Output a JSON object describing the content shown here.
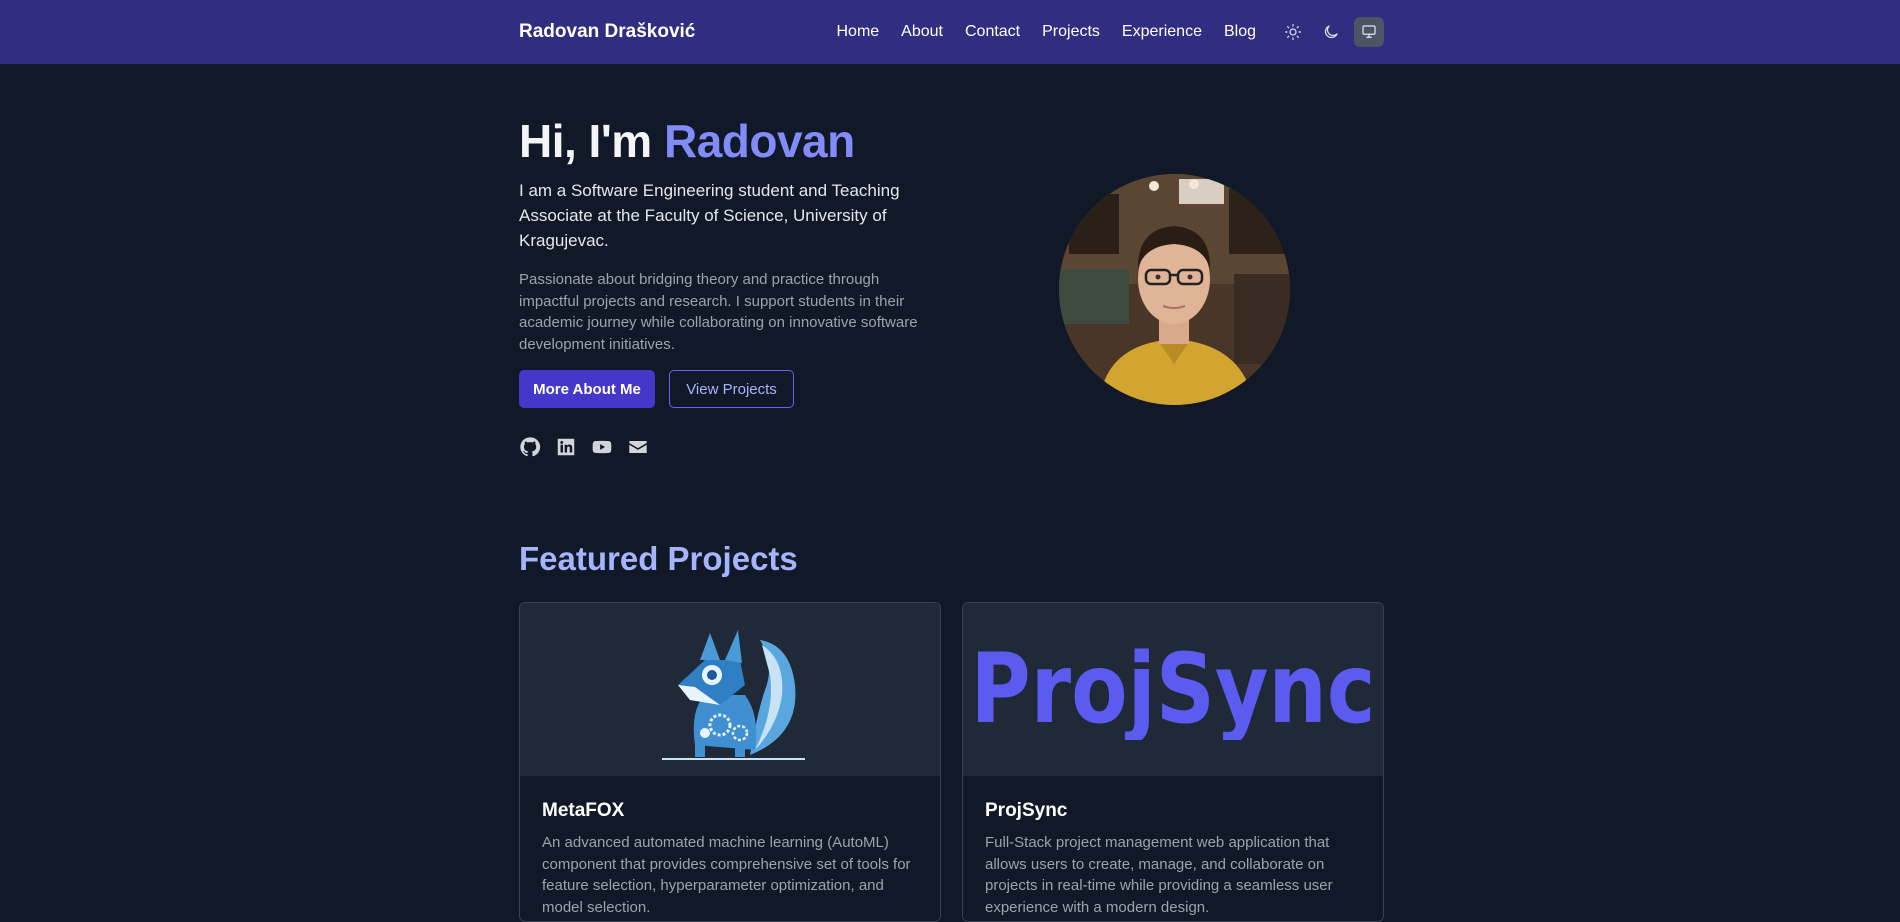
{
  "header": {
    "brand": "Radovan Drašković",
    "nav": [
      "Home",
      "About",
      "Contact",
      "Projects",
      "Experience",
      "Blog"
    ],
    "theme_buttons": [
      "sun-icon",
      "moon-icon",
      "monitor-icon"
    ],
    "active_theme": "monitor-icon"
  },
  "hero": {
    "greeting": "Hi, I'm ",
    "name": "Radovan",
    "subtitle": "I am a Software Engineering student and Teaching Associate at the Faculty of Science, University of Kragujevac.",
    "description": "Passionate about bridging theory and practice through impactful projects and research. I support students in their academic journey while collaborating on innovative software development initiatives.",
    "primary_button": "More About Me",
    "secondary_button": "View Projects",
    "socials": [
      "github-icon",
      "linkedin-icon",
      "youtube-icon",
      "mail-icon"
    ]
  },
  "featured": {
    "title": "Featured Projects",
    "projects": [
      {
        "title": "MetaFOX",
        "description": "An advanced automated machine learning (AutoML) component that provides comprehensive set of tools for feature selection, hyperparameter optimization, and model selection."
      },
      {
        "title": "ProjSync",
        "logo_text": "ProjSync",
        "description": "Full-Stack project management web application that allows users to create, manage, and collaborate on projects in real-time while providing a seamless user experience with a modern design."
      }
    ]
  },
  "colors": {
    "navbar": "#312e81",
    "background": "#111827",
    "accent": "#818cf8",
    "primary_button": "#4338ca",
    "projsync_logo": "#5b5bf0"
  }
}
